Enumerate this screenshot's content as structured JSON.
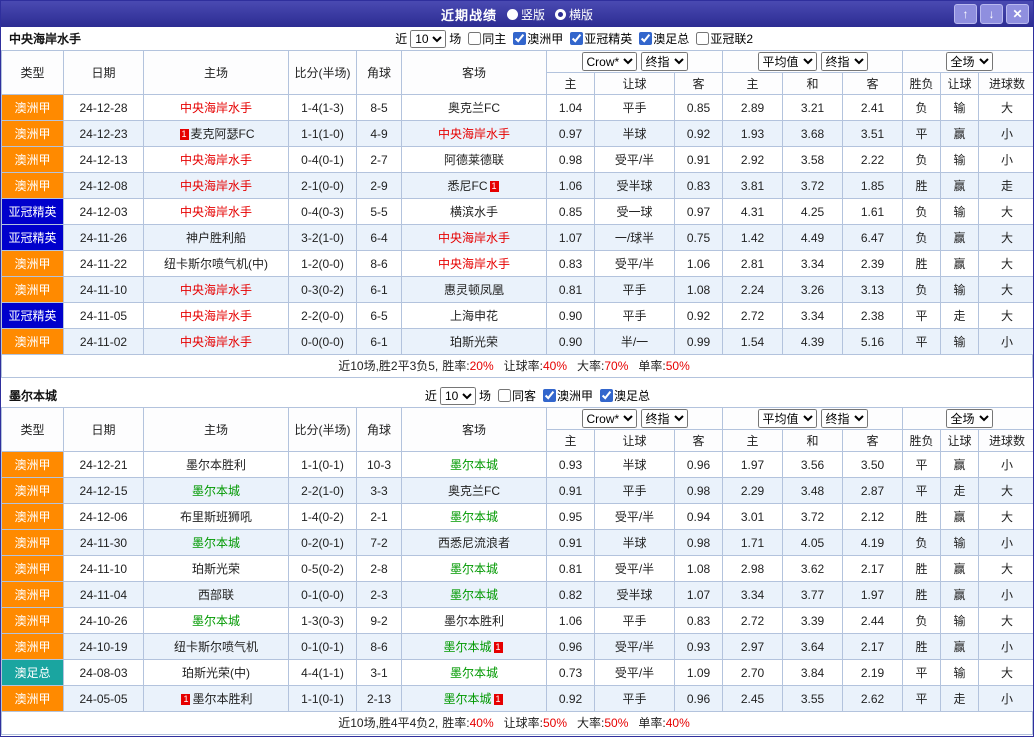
{
  "title_bar": {
    "title": "近期战绩",
    "vertical_label": "竖版",
    "horizontal_label": "横版",
    "selected_layout": "横版",
    "up_icon": "↑",
    "down_icon": "↓",
    "close_icon": "✕"
  },
  "colors": {
    "page_border": "#2f2f9d",
    "titlebar_top": "#4a4ab2",
    "titlebar_bottom": "#2c2c92",
    "button_bg": "#8f8fdf",
    "border": "#b3c3dd",
    "header_bg": "#fdfdfe",
    "row_alt": "#eaf2fb",
    "league_aus": "#ff8a00",
    "league_acl": "#0000cc",
    "league_aff": "#1aa5a0",
    "score_red": "#e60000",
    "team_red": "#e60000",
    "team_green": "#009900",
    "win": "#e60000",
    "lose": "#2121cc",
    "draw": "#009933"
  },
  "outcome_color_map": {
    "胜": "win",
    "赢": "win",
    "大": "win",
    "负": "lose",
    "输": "lose",
    "小": "lose",
    "平": "draw",
    "走": "draw"
  },
  "table_header": {
    "type": "类型",
    "date": "日期",
    "home": "主场",
    "score": "比分(半场)",
    "corner": "角球",
    "away": "客场",
    "odds_dropdowns_1": [
      "Crow*",
      "终指"
    ],
    "odds_dropdowns_2": [
      "平均值",
      "终指"
    ],
    "odds_dropdowns_3": [
      "全场"
    ],
    "sub_headers": [
      "主",
      "让球",
      "客",
      "主",
      "和",
      "客",
      "胜负",
      "让球",
      "进球数"
    ]
  },
  "sections": [
    {
      "team": "中央海岸水手",
      "team_color": "red",
      "filter": {
        "near": "近",
        "count": "10",
        "unit": "场",
        "checkboxes": [
          {
            "label": "同主",
            "checked": false
          },
          {
            "label": "澳洲甲",
            "checked": true
          },
          {
            "label": "亚冠精英",
            "checked": true
          },
          {
            "label": "澳足总",
            "checked": true
          },
          {
            "label": "亚冠联2",
            "checked": false
          }
        ]
      },
      "rows": [
        {
          "league": "澳洲甲",
          "lt": "aus",
          "date": "24-12-28",
          "home": "中央海岸水手",
          "home_hl": true,
          "score": "1-4(1-3)",
          "corner": "8-5",
          "away": "奥克兰FC",
          "odds": [
            "1.04",
            "平手",
            "0.85"
          ],
          "avg": [
            "2.89",
            "3.21",
            "2.41"
          ],
          "results": [
            "负",
            "输",
            "大"
          ]
        },
        {
          "league": "澳洲甲",
          "lt": "aus",
          "date": "24-12-23",
          "home_pre_card": "1",
          "home": "麦克阿瑟FC",
          "score": "1-1(1-0)",
          "corner": "4-9",
          "away": "中央海岸水手",
          "away_hl": true,
          "odds": [
            "0.97",
            "半球",
            "0.92"
          ],
          "avg": [
            "1.93",
            "3.68",
            "3.51"
          ],
          "results": [
            "平",
            "赢",
            "小"
          ]
        },
        {
          "league": "澳洲甲",
          "lt": "aus",
          "date": "24-12-13",
          "home": "中央海岸水手",
          "home_hl": true,
          "score": "0-4(0-1)",
          "corner": "2-7",
          "away": "阿德莱德联",
          "odds": [
            "0.98",
            "受平/半",
            "0.91"
          ],
          "avg": [
            "2.92",
            "3.58",
            "2.22"
          ],
          "results": [
            "负",
            "输",
            "小"
          ]
        },
        {
          "league": "澳洲甲",
          "lt": "aus",
          "date": "24-12-08",
          "home": "中央海岸水手",
          "home_hl": true,
          "score": "2-1(0-0)",
          "corner": "2-9",
          "away": "悉尼FC",
          "away_post_card": "1",
          "odds": [
            "1.06",
            "受半球",
            "0.83"
          ],
          "avg": [
            "3.81",
            "3.72",
            "1.85"
          ],
          "results": [
            "胜",
            "赢",
            "走"
          ]
        },
        {
          "league": "亚冠精英",
          "lt": "acl",
          "date": "24-12-03",
          "home": "中央海岸水手",
          "home_hl": true,
          "score": "0-4(0-3)",
          "corner": "5-5",
          "away": "横滨水手",
          "odds": [
            "0.85",
            "受一球",
            "0.97"
          ],
          "avg": [
            "4.31",
            "4.25",
            "1.61"
          ],
          "results": [
            "负",
            "输",
            "大"
          ]
        },
        {
          "league": "亚冠精英",
          "lt": "acl",
          "date": "24-11-26",
          "home": "神户胜利船",
          "score": "3-2(1-0)",
          "corner": "6-4",
          "away": "中央海岸水手",
          "away_hl": true,
          "odds": [
            "1.07",
            "一/球半",
            "0.75"
          ],
          "avg": [
            "1.42",
            "4.49",
            "6.47"
          ],
          "results": [
            "负",
            "赢",
            "大"
          ]
        },
        {
          "league": "澳洲甲",
          "lt": "aus",
          "date": "24-11-22",
          "home": "纽卡斯尔喷气机(中)",
          "score": "1-2(0-0)",
          "corner": "8-6",
          "away": "中央海岸水手",
          "away_hl": true,
          "odds": [
            "0.83",
            "受平/半",
            "1.06"
          ],
          "avg": [
            "2.81",
            "3.34",
            "2.39"
          ],
          "results": [
            "胜",
            "赢",
            "大"
          ]
        },
        {
          "league": "澳洲甲",
          "lt": "aus",
          "date": "24-11-10",
          "home": "中央海岸水手",
          "home_hl": true,
          "score": "0-3(0-2)",
          "corner": "6-1",
          "away": "惠灵顿凤凰",
          "odds": [
            "0.81",
            "平手",
            "1.08"
          ],
          "avg": [
            "2.24",
            "3.26",
            "3.13"
          ],
          "results": [
            "负",
            "输",
            "大"
          ]
        },
        {
          "league": "亚冠精英",
          "lt": "acl",
          "date": "24-11-05",
          "home": "中央海岸水手",
          "home_hl": true,
          "score": "2-2(0-0)",
          "corner": "6-5",
          "away": "上海申花",
          "odds": [
            "0.90",
            "平手",
            "0.92"
          ],
          "avg": [
            "2.72",
            "3.34",
            "2.38"
          ],
          "results": [
            "平",
            "走",
            "大"
          ]
        },
        {
          "league": "澳洲甲",
          "lt": "aus",
          "date": "24-11-02",
          "home": "中央海岸水手",
          "home_hl": true,
          "score": "0-0(0-0)",
          "corner": "6-1",
          "away": "珀斯光荣",
          "odds": [
            "0.90",
            "半/一",
            "0.99"
          ],
          "avg": [
            "1.54",
            "4.39",
            "5.16"
          ],
          "results": [
            "平",
            "输",
            "小"
          ]
        }
      ],
      "summary": {
        "prefix": "近10场,胜2平3负5,",
        "stats": [
          {
            "label": "胜率:",
            "value": "20%"
          },
          {
            "label": "让球率:",
            "value": "40%"
          },
          {
            "label": "大率:",
            "value": "70%"
          },
          {
            "label": "单率:",
            "value": "50%"
          }
        ]
      }
    },
    {
      "team": "墨尔本城",
      "team_color": "green",
      "filter": {
        "near": "近",
        "count": "10",
        "unit": "场",
        "checkboxes": [
          {
            "label": "同客",
            "checked": false
          },
          {
            "label": "澳洲甲",
            "checked": true
          },
          {
            "label": "澳足总",
            "checked": true
          }
        ]
      },
      "rows": [
        {
          "league": "澳洲甲",
          "lt": "aus",
          "date": "24-12-21",
          "home": "墨尔本胜利",
          "score": "1-1(0-1)",
          "corner": "10-3",
          "away": "墨尔本城",
          "away_hl": true,
          "odds": [
            "0.93",
            "半球",
            "0.96"
          ],
          "avg": [
            "1.97",
            "3.56",
            "3.50"
          ],
          "results": [
            "平",
            "赢",
            "小"
          ]
        },
        {
          "league": "澳洲甲",
          "lt": "aus",
          "date": "24-12-15",
          "home": "墨尔本城",
          "home_hl": true,
          "score": "2-2(1-0)",
          "corner": "3-3",
          "away": "奥克兰FC",
          "odds": [
            "0.91",
            "平手",
            "0.98"
          ],
          "avg": [
            "2.29",
            "3.48",
            "2.87"
          ],
          "results": [
            "平",
            "走",
            "大"
          ]
        },
        {
          "league": "澳洲甲",
          "lt": "aus",
          "date": "24-12-06",
          "home": "布里斯班狮吼",
          "score": "1-4(0-2)",
          "corner": "2-1",
          "away": "墨尔本城",
          "away_hl": true,
          "odds": [
            "0.95",
            "受平/半",
            "0.94"
          ],
          "avg": [
            "3.01",
            "3.72",
            "2.12"
          ],
          "results": [
            "胜",
            "赢",
            "大"
          ]
        },
        {
          "league": "澳洲甲",
          "lt": "aus",
          "date": "24-11-30",
          "home": "墨尔本城",
          "home_hl": true,
          "score": "0-2(0-1)",
          "corner": "7-2",
          "away": "西悉尼流浪者",
          "odds": [
            "0.91",
            "半球",
            "0.98"
          ],
          "avg": [
            "1.71",
            "4.05",
            "4.19"
          ],
          "results": [
            "负",
            "输",
            "小"
          ]
        },
        {
          "league": "澳洲甲",
          "lt": "aus",
          "date": "24-11-10",
          "home": "珀斯光荣",
          "score": "0-5(0-2)",
          "corner": "2-8",
          "away": "墨尔本城",
          "away_hl": true,
          "odds": [
            "0.81",
            "受平/半",
            "1.08"
          ],
          "avg": [
            "2.98",
            "3.62",
            "2.17"
          ],
          "results": [
            "胜",
            "赢",
            "大"
          ]
        },
        {
          "league": "澳洲甲",
          "lt": "aus",
          "date": "24-11-04",
          "home": "西部联",
          "score": "0-1(0-0)",
          "corner": "2-3",
          "away": "墨尔本城",
          "away_hl": true,
          "odds": [
            "0.82",
            "受半球",
            "1.07"
          ],
          "avg": [
            "3.34",
            "3.77",
            "1.97"
          ],
          "results": [
            "胜",
            "赢",
            "小"
          ]
        },
        {
          "league": "澳洲甲",
          "lt": "aus",
          "date": "24-10-26",
          "home": "墨尔本城",
          "home_hl": true,
          "score": "1-3(0-3)",
          "corner": "9-2",
          "away": "墨尔本胜利",
          "odds": [
            "1.06",
            "平手",
            "0.83"
          ],
          "avg": [
            "2.72",
            "3.39",
            "2.44"
          ],
          "results": [
            "负",
            "输",
            "大"
          ]
        },
        {
          "league": "澳洲甲",
          "lt": "aus",
          "date": "24-10-19",
          "home": "纽卡斯尔喷气机",
          "score": "0-1(0-1)",
          "corner": "8-6",
          "away": "墨尔本城",
          "away_hl": true,
          "away_post_card": "1",
          "odds": [
            "0.96",
            "受平/半",
            "0.93"
          ],
          "avg": [
            "2.97",
            "3.64",
            "2.17"
          ],
          "results": [
            "胜",
            "赢",
            "小"
          ]
        },
        {
          "league": "澳足总",
          "lt": "aff",
          "date": "24-08-03",
          "home": "珀斯光荣(中)",
          "score": "4-4(1-1)",
          "corner": "3-1",
          "away": "墨尔本城",
          "away_hl": true,
          "odds": [
            "0.73",
            "受平/半",
            "1.09"
          ],
          "avg": [
            "2.70",
            "3.84",
            "2.19"
          ],
          "results": [
            "平",
            "输",
            "大"
          ]
        },
        {
          "league": "澳洲甲",
          "lt": "aus",
          "date": "24-05-05",
          "home_pre_card": "1",
          "home": "墨尔本胜利",
          "score": "1-1(0-1)",
          "corner": "2-13",
          "away": "墨尔本城",
          "away_hl": true,
          "away_post_card": "1",
          "odds": [
            "0.92",
            "平手",
            "0.96"
          ],
          "avg": [
            "2.45",
            "3.55",
            "2.62"
          ],
          "results": [
            "平",
            "走",
            "小"
          ]
        }
      ],
      "summary": {
        "prefix": "近10场,胜4平4负2,",
        "stats": [
          {
            "label": "胜率:",
            "value": "40%"
          },
          {
            "label": "让球率:",
            "value": "50%"
          },
          {
            "label": "大率:",
            "value": "50%"
          },
          {
            "label": "单率:",
            "value": "40%"
          }
        ]
      }
    }
  ]
}
